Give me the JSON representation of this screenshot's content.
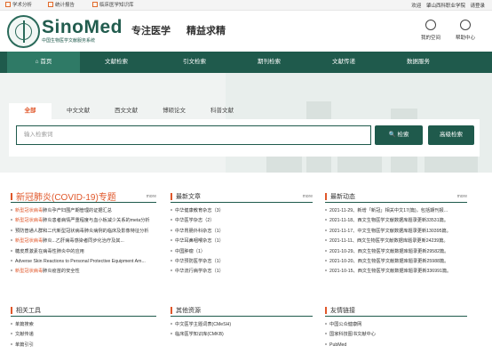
{
  "topbar": {
    "links": [
      "学术分析",
      "统计报告",
      "临床医学知识库"
    ],
    "welcome": "欢迎",
    "org": "肇山西科职业学院",
    "logout": "请登录"
  },
  "header": {
    "brand": "SinoMed",
    "brand_sub": "中国生物医学文献服务系统",
    "slogan1": "专注医学",
    "slogan2": "精益求精",
    "my_space": "我的空间",
    "help": "帮助中心"
  },
  "nav": {
    "items": [
      "首页",
      "文献检索",
      "引文检索",
      "期刊检索",
      "文献传递",
      "数据服务"
    ],
    "home_icon": "home-icon"
  },
  "search": {
    "tabs": [
      "全部",
      "中文文献",
      "西文文献",
      "博硕论文",
      "科普文献"
    ],
    "placeholder": "输入检索词",
    "search_btn": "检索",
    "adv_btn": "高级检索"
  },
  "covid": {
    "title": "新冠肺炎(COVID-19)专题",
    "more": "more",
    "items": [
      {
        "hl": "新型冠状病毒",
        "text": "肺炎孕产妇围产期管理的证据汇总"
      },
      {
        "hl": "新型冠状病毒",
        "text": "肺炎患者病情严重程度与血小板减少关系的meta分析"
      },
      {
        "hl": "",
        "text": "预防普通人群和二代新型冠状病毒肺炎病例的临床及影像特征分析"
      },
      {
        "hl": "新型冠状病毒",
        "text": "肺炎...乙肝病毒感染者同步化治疗及其..."
      },
      {
        "hl": "",
        "text": "糖皮质激素在病毒性肺炎中的应用"
      },
      {
        "hl": "",
        "text": "Adverse Skin Reactions to Personal Protective Equipment Am..."
      },
      {
        "hl": "新型冠状病毒",
        "text": "肺炎疫苗的安全性"
      }
    ]
  },
  "latest_journals": {
    "title": "最新文章",
    "more": "more",
    "items": [
      "中华健康教育杂志（3）",
      "中华医学杂志（2）",
      "中华胃肠外科杂志（1）",
      "中华耳鼻咽喉杂志（1）",
      "中国肿瘤（1）",
      "中华预防医学杂志（1）",
      "中华流行病学杂志（1）"
    ]
  },
  "latest_news": {
    "title": "最新动态",
    "more": "more",
    "items": [
      "2021-11-29、新增「新冠」相关中文17(篇)，包括期刊报...",
      "2021-11-18、西文生物医学文献数据库题录更新33531篇。",
      "2021-11-17、中文生物医学文献数据库题录更新130395篇。",
      "2021-11-11、西文生物医学文献数据库题录更新24239篇。",
      "2021-10-29、西文生物医学文献数据库题录更新29582篇。",
      "2021-10-20、西文生物医学文献数据库题录更新25988篇。",
      "2021-10-15、西文生物医学文献数据库题录更新336991篇。"
    ]
  },
  "tools": {
    "title": "相关工具",
    "items": [
      "单篇搜索",
      "文献传递",
      "单篇引引"
    ]
  },
  "other_resources": {
    "title": "其他资源",
    "items": [
      "中文医学主题词表(CMeSH)",
      "临床医学知识库(CMKB)"
    ]
  },
  "friend_links": {
    "title": "友情链接",
    "items": [
      "中国公众健康网",
      "国家科技图书文献中心",
      "PubMed"
    ]
  }
}
